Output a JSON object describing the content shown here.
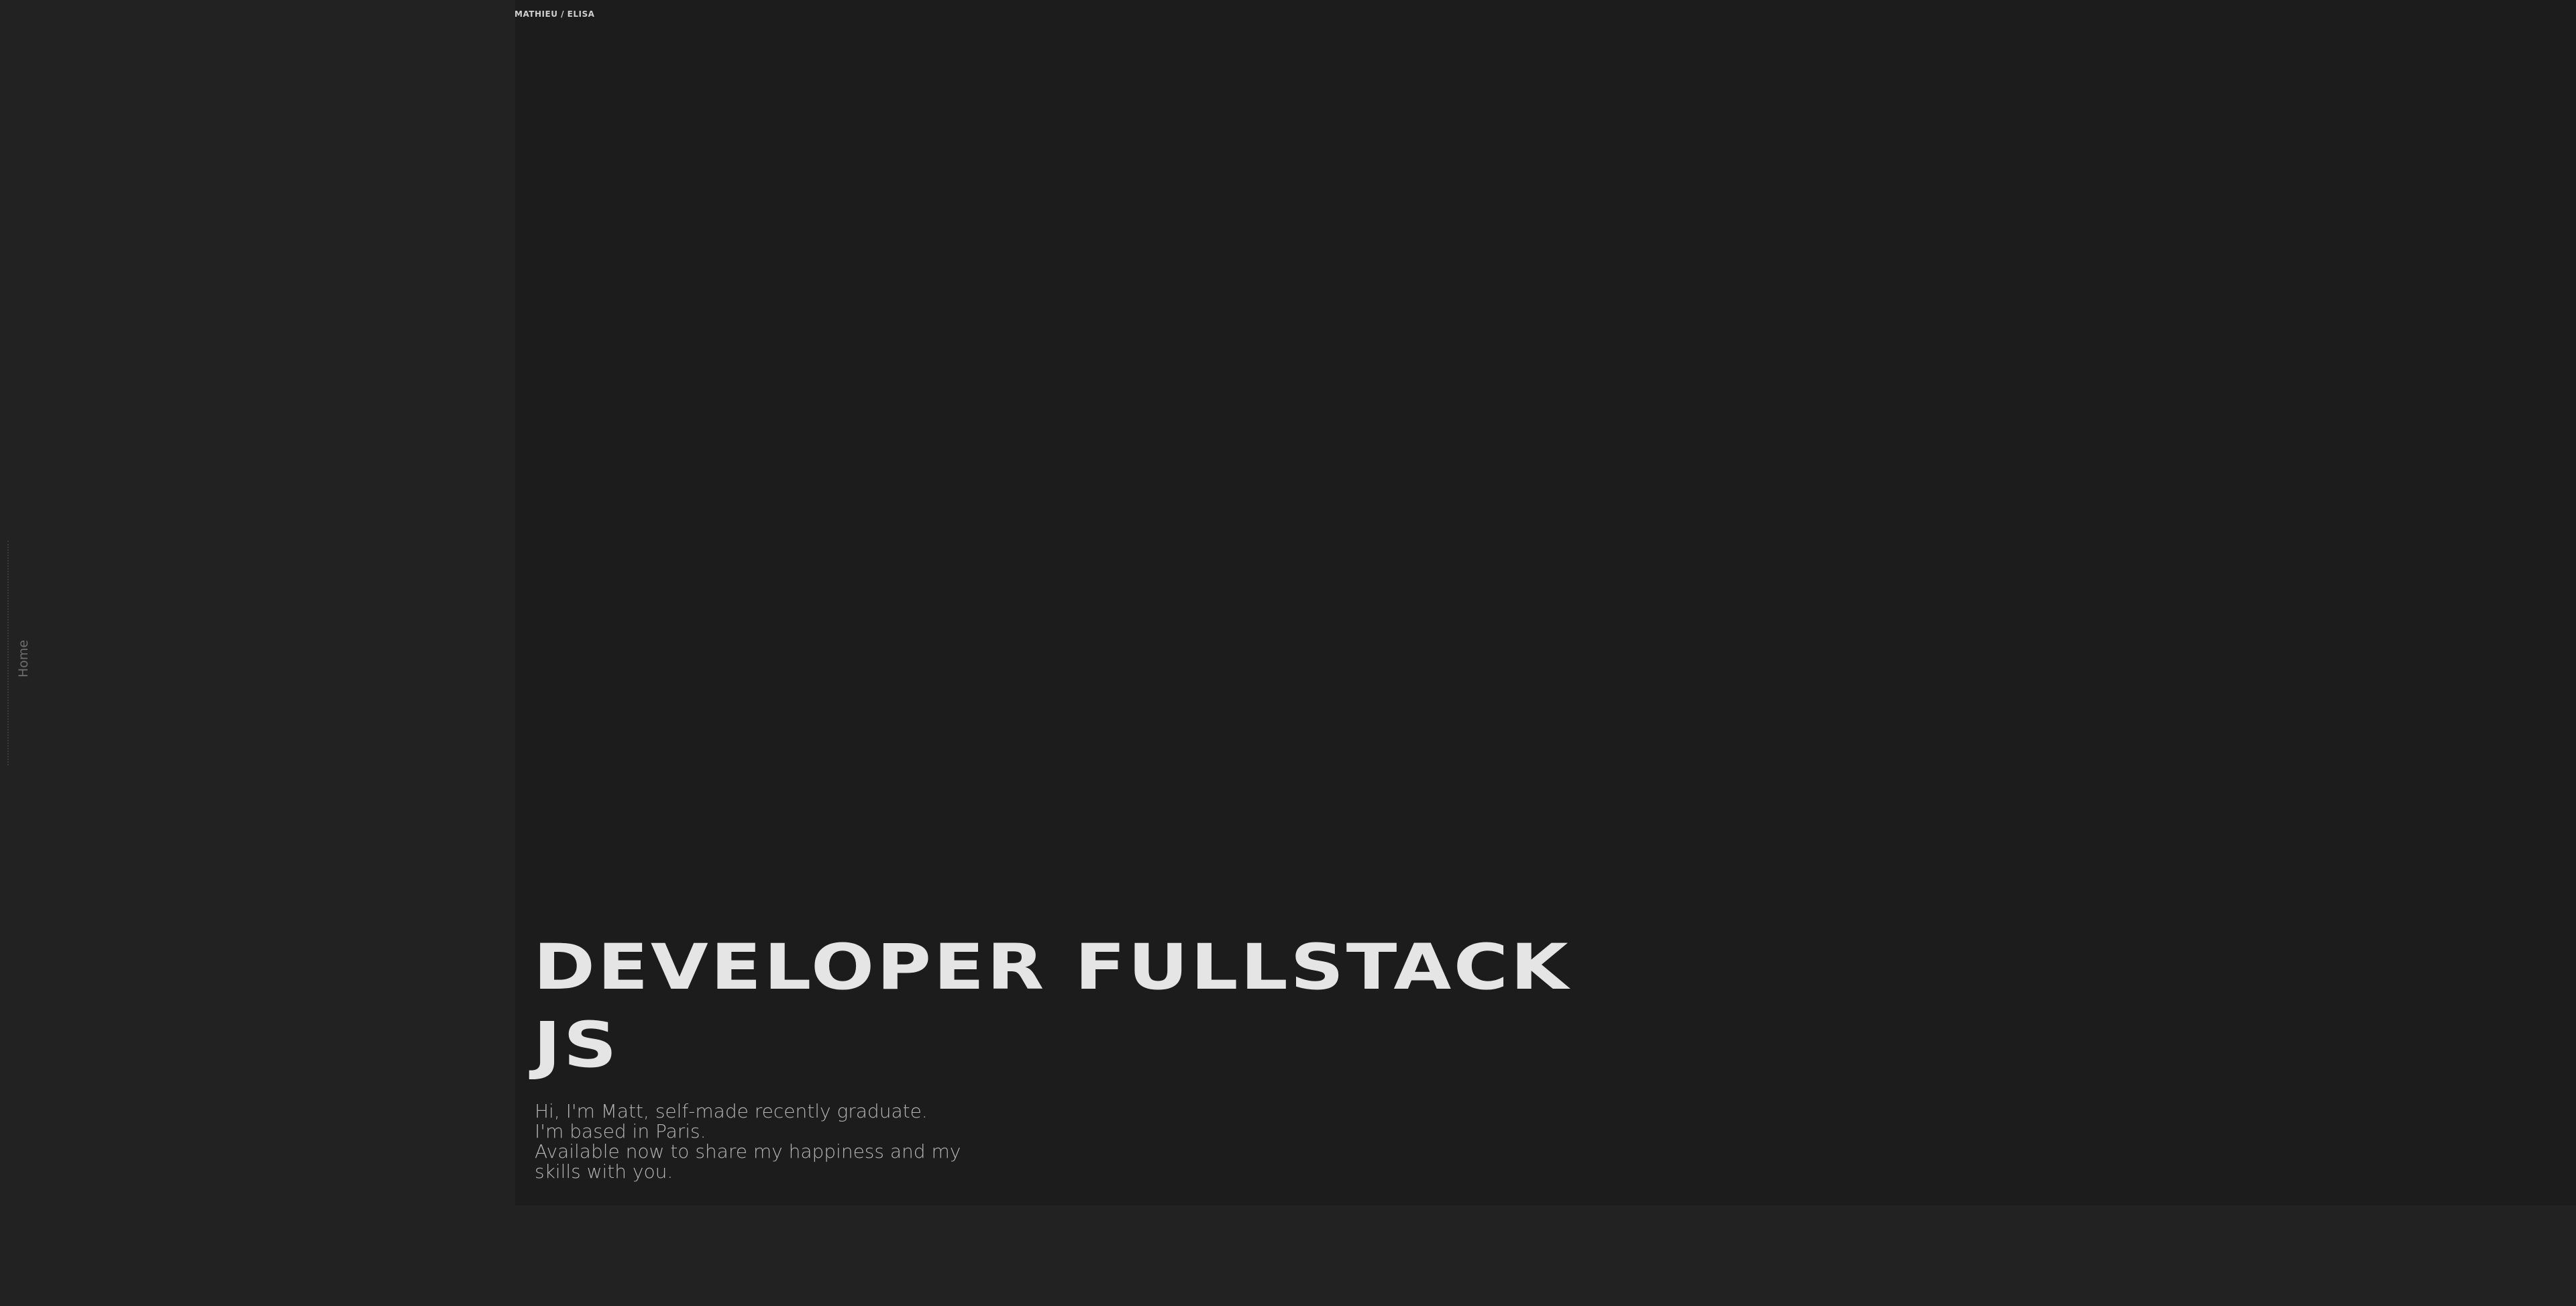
{
  "header": {
    "brand": "MATHIEU / ELISA"
  },
  "sidebar": {
    "nav_label": "Home"
  },
  "hero": {
    "headline_line1": "DEVELOPER FULLSTACK",
    "headline_line2": "JS",
    "intro_lines": [
      "Hi, I'm Matt, self-made recently graduate.",
      "I'm based in Paris.",
      "Available now to share my happiness and my",
      "skills with you."
    ]
  },
  "colors": {
    "page_background": "#222222",
    "hero_background": "#1c1c1c",
    "headline": "#e5e5e5",
    "body_text": "#b5b5b5"
  }
}
